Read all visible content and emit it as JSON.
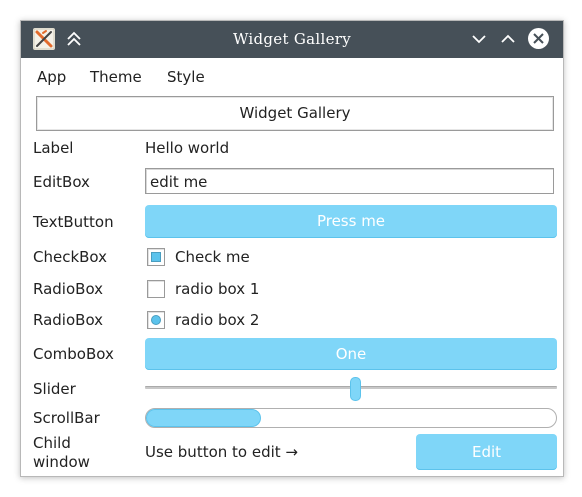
{
  "window": {
    "title": "Widget Gallery"
  },
  "titlebar_icons": {
    "app_icon": "x-app-icon",
    "keep_above": "double-chevron-up-icon",
    "minimize": "chevron-down-icon",
    "maximize": "chevron-up-icon",
    "close": "close-icon"
  },
  "menu": {
    "items": [
      "App",
      "Theme",
      "Style"
    ]
  },
  "banner": {
    "label": "Widget Gallery"
  },
  "rows": {
    "label": {
      "name": "Label",
      "value": "Hello world"
    },
    "editbox": {
      "name": "EditBox",
      "value": "edit me"
    },
    "textbutton": {
      "name": "TextButton",
      "button_label": "Press me"
    },
    "checkbox": {
      "name": "CheckBox",
      "label": "Check me",
      "checked": true
    },
    "radiobox1": {
      "name": "RadioBox",
      "label": "radio box 1",
      "selected": false
    },
    "radiobox2": {
      "name": "RadioBox",
      "label": "radio box 2",
      "selected": true
    },
    "combobox": {
      "name": "ComboBox",
      "selected": "One"
    },
    "slider": {
      "name": "Slider",
      "value_fraction": 0.51
    },
    "scrollbar": {
      "name": "ScrollBar",
      "thumb_fraction": 0.28
    },
    "child_window": {
      "name_line1": "Child",
      "name_line2": "window",
      "text": "Use button to edit →",
      "button_label": "Edit"
    }
  },
  "colors": {
    "accent": "#7fd6f8",
    "accent_border": "#5cc3ec",
    "titlebar": "#465058"
  }
}
